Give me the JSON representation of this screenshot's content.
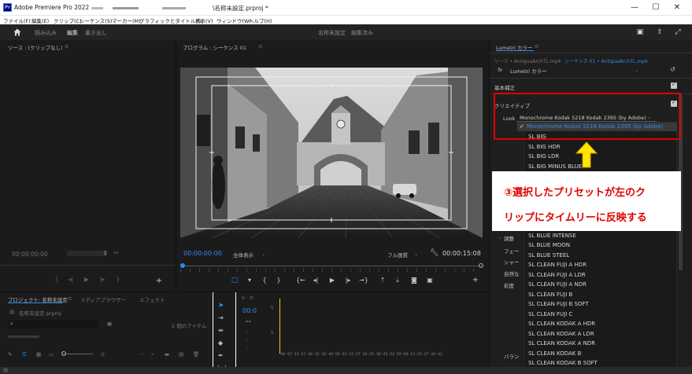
{
  "window": {
    "title": "Adobe Premiere Pro 2022 -",
    "title_suffix": "\\名称未設定.prproj *",
    "minimize": "—",
    "maximize": "☐",
    "close": "✕"
  },
  "menu": [
    "ファイル(F)",
    "編集(E)",
    "クリップ(C)",
    "シーケンス(S)",
    "マーカー(M)",
    "グラフィックとタイトル(G)",
    "表示(V)",
    "ウィンドウ(W)",
    "ヘルプ(H)"
  ],
  "header": {
    "workspaces": [
      "読み込み",
      "編集",
      "書き出し"
    ],
    "project_name": "名称未設定",
    "save_state": "編集済み"
  },
  "source": {
    "title": "ソース : (クリップなし)",
    "timecode": "00;00;00;00"
  },
  "program": {
    "title": "プログラム : シーケンス 01",
    "timecode": "00:00:00:00",
    "zoom": "全体表示",
    "quality": "フル画質",
    "duration": "00:00:15:08"
  },
  "lumetri": {
    "title": "Lumetri カラー",
    "source_path": "ソース • AntiguaArchTL.mp4",
    "sequence_path": "シーケンス 01 • AntiguaArchTL.mp4",
    "fx_label": "fx",
    "effect": "Lumetri カラー",
    "basic_correction": "基本補正",
    "creative": "クリエイティブ",
    "look_label": "Look",
    "look_value": "Monochrome Kodak 5218 Kodak 2395 (by Adobe)",
    "side_labels": [
      "調整",
      "フェー",
      "シャー",
      "自然な",
      "彩度",
      "バラン"
    ],
    "dropdown_selected": "Monochrome Kodak 5218 Kodak 2395 (by Adobe)",
    "dropdown_items": [
      "SL BIG",
      "SL BIG HDR",
      "SL BIG LDR",
      "SL BIG MINUS BLUE",
      "SL BLUE INTENSE",
      "SL BLUE MOON",
      "SL BLUE STEEL",
      "SL CLEAN FUJI A HDR",
      "SL CLEAN FUJI A LDR",
      "SL CLEAN FUJI A NDR",
      "SL CLEAN FUJI B",
      "SL CLEAN FUJI B SOFT",
      "SL CLEAN FUJI C",
      "SL CLEAN KODAK A HDR",
      "SL CLEAN KODAK A LDR",
      "SL CLEAN KODAK A NDR",
      "SL CLEAN KODAK B",
      "SL CLEAN KODAK B SOFT"
    ]
  },
  "annotation": {
    "line1": "③選択したプリセットが左のク",
    "line2": "リップにタイムリーに反映する"
  },
  "project": {
    "tabs": [
      "プロジェクト: 名称未設定",
      "メディアブラウザー",
      "エフェクト"
    ],
    "file": "名称未設定.prproj",
    "item_count": "2 個のアイテム"
  },
  "timeline": {
    "timecode": "00:0",
    "ruler": "-00  :07  :14  :21  :28  :35  :42  :49  :56  :03  :10  :17  :24  :31  :38  :45  :52  :59  :06  :13  :20  :27  :34  :41"
  },
  "colors": {
    "accent_blue": "#2d8ceb",
    "annotation_red": "#e00000",
    "arrow_yellow": "#ffe600"
  }
}
